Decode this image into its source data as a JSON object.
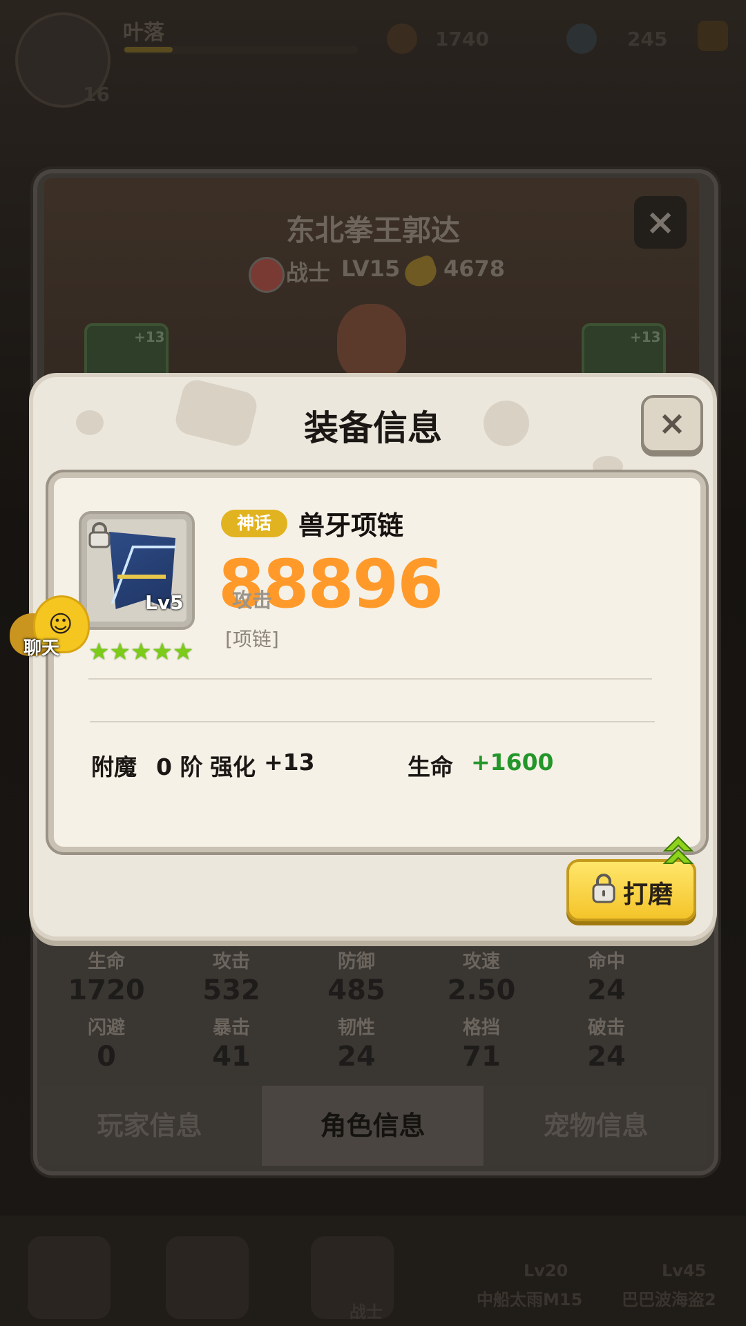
{
  "hud": {
    "player_name": "叶落",
    "gold": "1740",
    "gems": "245",
    "level_badge": "16"
  },
  "character": {
    "name": "东北拳王郭达",
    "class": "战士",
    "level": "LV15",
    "power": "4678",
    "left_slot_plus": "+13",
    "right_slot_plus": "+13"
  },
  "stats": [
    {
      "label": "生命",
      "value": "1720"
    },
    {
      "label": "攻击",
      "value": "532"
    },
    {
      "label": "防御",
      "value": "485"
    },
    {
      "label": "攻速",
      "value": "2.50"
    },
    {
      "label": "命中",
      "value": "24"
    },
    {
      "label": "闪避",
      "value": "0"
    },
    {
      "label": "暴击",
      "value": "41"
    },
    {
      "label": "韧性",
      "value": "24"
    },
    {
      "label": "格挡",
      "value": "71"
    },
    {
      "label": "破击",
      "value": "24"
    }
  ],
  "tabs": [
    {
      "label": "玩家信息",
      "active": false
    },
    {
      "label": "角色信息",
      "active": true
    },
    {
      "label": "宠物信息",
      "active": false
    }
  ],
  "chat": {
    "label": "聊天"
  },
  "dialog": {
    "title": "装备信息",
    "close_symbol": "×",
    "item": {
      "rarity": "神话",
      "name": "兽牙项链",
      "level": "Lv5",
      "stars": "★★★★★",
      "power": "88896",
      "power_label": "攻击",
      "type": "[项链]"
    },
    "enchant_label": "附魔",
    "enchant_value": "0 阶",
    "enhance_label": "强化",
    "enhance_value": "+13",
    "bonus_stat_label": "生命",
    "bonus_stat_value": "+1600",
    "grind_button": "打磨"
  },
  "bottom_nav": {
    "left_caption": "战士",
    "item_a_level": "Lv20",
    "item_a_name": "中船太雨M15",
    "item_b_level": "Lv45",
    "item_b_name": "巴巴波海盗2"
  },
  "colors": {
    "power_orange": "#ff9a2a",
    "rarity_gold": "#e2b320",
    "bonus_green": "#23962a",
    "star_green": "#7ccb18"
  }
}
